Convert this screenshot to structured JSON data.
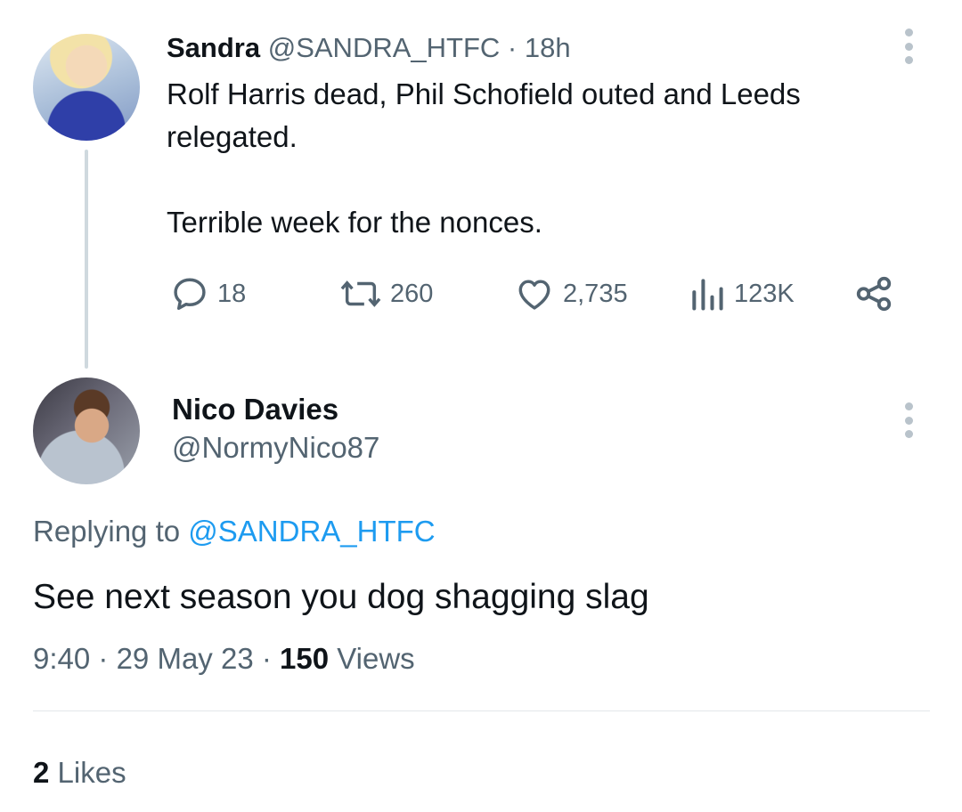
{
  "tweet": {
    "author_name": "Sandra",
    "author_handle": "@SANDRA_HTFC",
    "separator": "·",
    "time": "18h",
    "text_line1": "Rolf Harris dead, Phil Schofield outed and Leeds relegated.",
    "text_line2": "Terrible week for the nonces.",
    "actions": {
      "replies": "18",
      "retweets": "260",
      "likes": "2,735",
      "views": "123K"
    }
  },
  "reply": {
    "author_name": "Nico Davies",
    "author_handle": "@NormyNico87",
    "replying_prefix": "Replying to",
    "replying_to": "@SANDRA_HTFC",
    "text": "See next season you dog shagging slag",
    "time": "9:40",
    "separator": "·",
    "date": "29 May 23",
    "views_count": "150",
    "views_label": "Views",
    "likes_count": "2",
    "likes_label": "Likes"
  },
  "icons": {
    "reply": "reply-icon",
    "retweet": "retweet-icon",
    "like": "heart-icon",
    "views": "views-icon",
    "share": "share-icon",
    "more": "more-icon"
  },
  "colors": {
    "text": "#0f1419",
    "muted": "#536471",
    "link": "#1d9bf0",
    "divider": "#e3e7ea"
  }
}
